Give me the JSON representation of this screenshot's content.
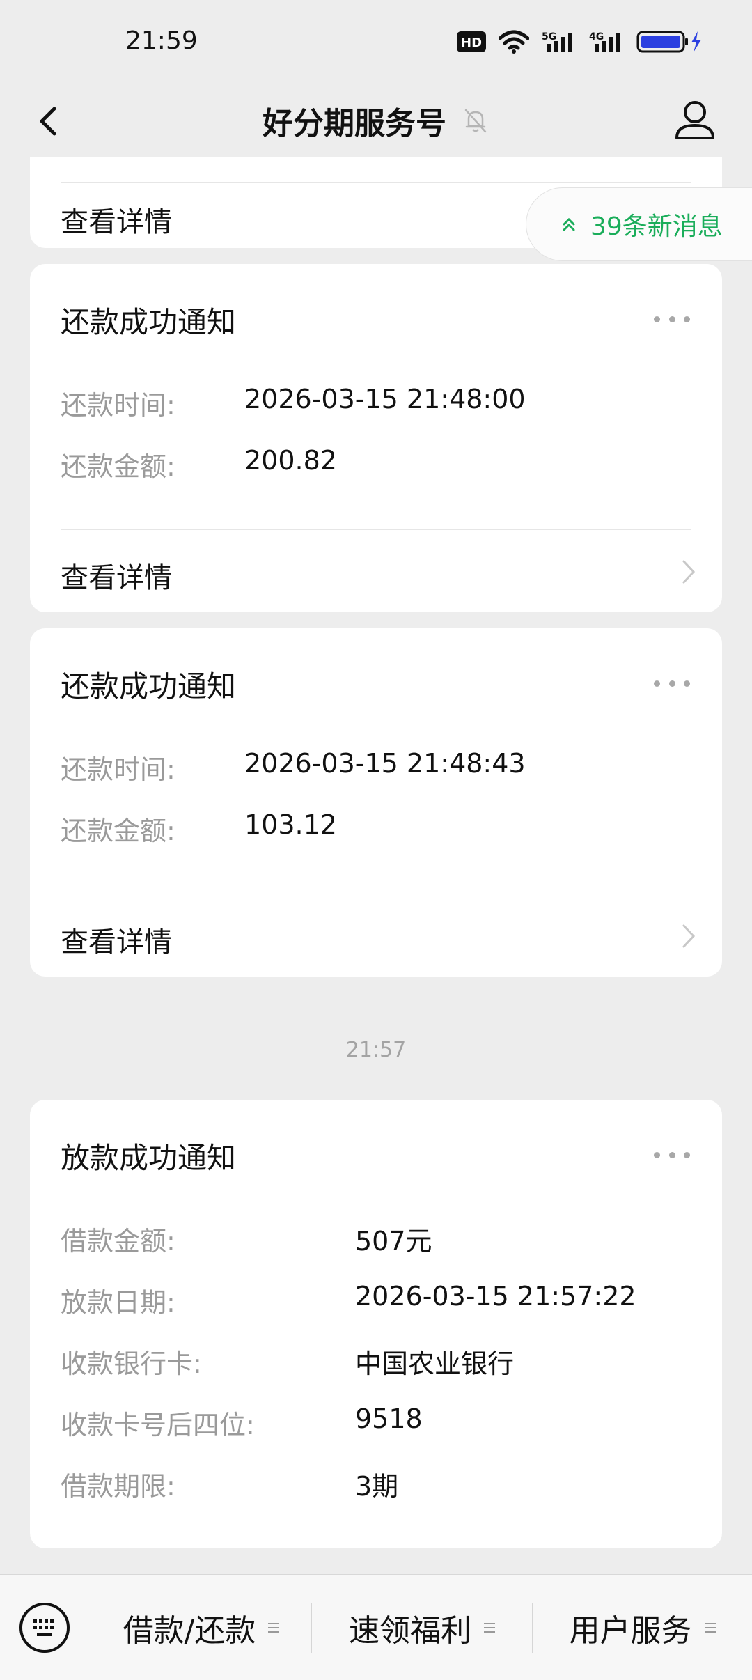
{
  "status_bar": {
    "time": "21:59",
    "hd_label": "HD",
    "net1_label": "5G",
    "net2_label": "4G"
  },
  "nav": {
    "title": "好分期服务号",
    "back_icon": "chevron-left-icon",
    "mute_icon": "bell-off-icon",
    "profile_icon": "user-icon"
  },
  "new_messages": {
    "label": "39条新消息",
    "color": "#1aad5a"
  },
  "partial_card": {
    "detail_label": "查看详情"
  },
  "repayment_cards": [
    {
      "title": "还款成功通知",
      "fields": [
        {
          "label": "还款时间:",
          "value": "2026-03-15 21:48:00"
        },
        {
          "label": "还款金额:",
          "value": "200.82"
        }
      ],
      "detail_label": "查看详情"
    },
    {
      "title": "还款成功通知",
      "fields": [
        {
          "label": "还款时间:",
          "value": "2026-03-15 21:48:43"
        },
        {
          "label": "还款金额:",
          "value": "103.12"
        }
      ],
      "detail_label": "查看详情"
    }
  ],
  "timestamp": "21:57",
  "loan_card": {
    "title": "放款成功通知",
    "fields": [
      {
        "label": "借款金额:",
        "value": "507元"
      },
      {
        "label": "放款日期:",
        "value": "2026-03-15 21:57:22"
      },
      {
        "label": "收款银行卡:",
        "value": "中国农业银行"
      },
      {
        "label": "收款卡号后四位:",
        "value": "9518"
      },
      {
        "label": "借款期限:",
        "value": "3期"
      }
    ]
  },
  "bottom_menu": {
    "keyboard_icon": "keyboard-icon",
    "items": [
      {
        "label": "借款/还款"
      },
      {
        "label": "速领福利"
      },
      {
        "label": "用户服务"
      }
    ]
  }
}
